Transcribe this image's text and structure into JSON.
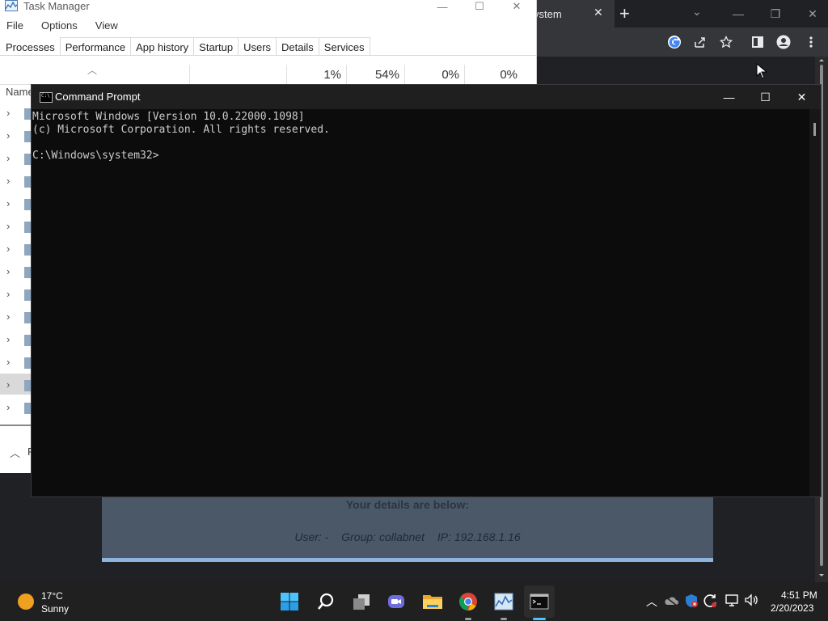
{
  "browser": {
    "tab_title": "ystem",
    "tab_close": "✕",
    "new_tab": "+",
    "caret": "⌄",
    "win_ctrls": [
      "—",
      "❐",
      "✕"
    ],
    "webpage": {
      "heading": "Your details are below:",
      "user": "User: -",
      "group": "Group: collabnet",
      "ip": "IP: 192.168.1.16"
    }
  },
  "task_manager": {
    "title": "Task Manager",
    "menu": [
      "File",
      "Options",
      "View"
    ],
    "tabs": [
      "Processes",
      "Performance",
      "App history",
      "Startup",
      "Users",
      "Details",
      "Services"
    ],
    "active_tab": "Processes",
    "columns": {
      "name": "Name",
      "cpu": "1%",
      "memory": "54%",
      "disk": "0%",
      "network": "0%"
    },
    "footer_text": "F"
  },
  "cmd": {
    "title": "Command Prompt",
    "lines": [
      "Microsoft Windows [Version 10.0.22000.1098]",
      "(c) Microsoft Corporation. All rights reserved.",
      "",
      "C:\\Windows\\system32>"
    ]
  },
  "taskbar": {
    "weather": {
      "temp": "17°C",
      "desc": "Sunny"
    },
    "apps": [
      "start-icon",
      "search-icon",
      "task-view-icon",
      "chat-icon",
      "file-explorer-icon",
      "chrome-icon",
      "task-manager-icon",
      "command-prompt-icon"
    ],
    "clock": {
      "time": "4:51 PM",
      "date": "2/20/2023"
    }
  },
  "colors": {
    "cmd_bg": "#0c0c0c",
    "cmd_text": "#cccccc",
    "taskbar_bg": "#202020",
    "accent": "#4cc2ff"
  }
}
